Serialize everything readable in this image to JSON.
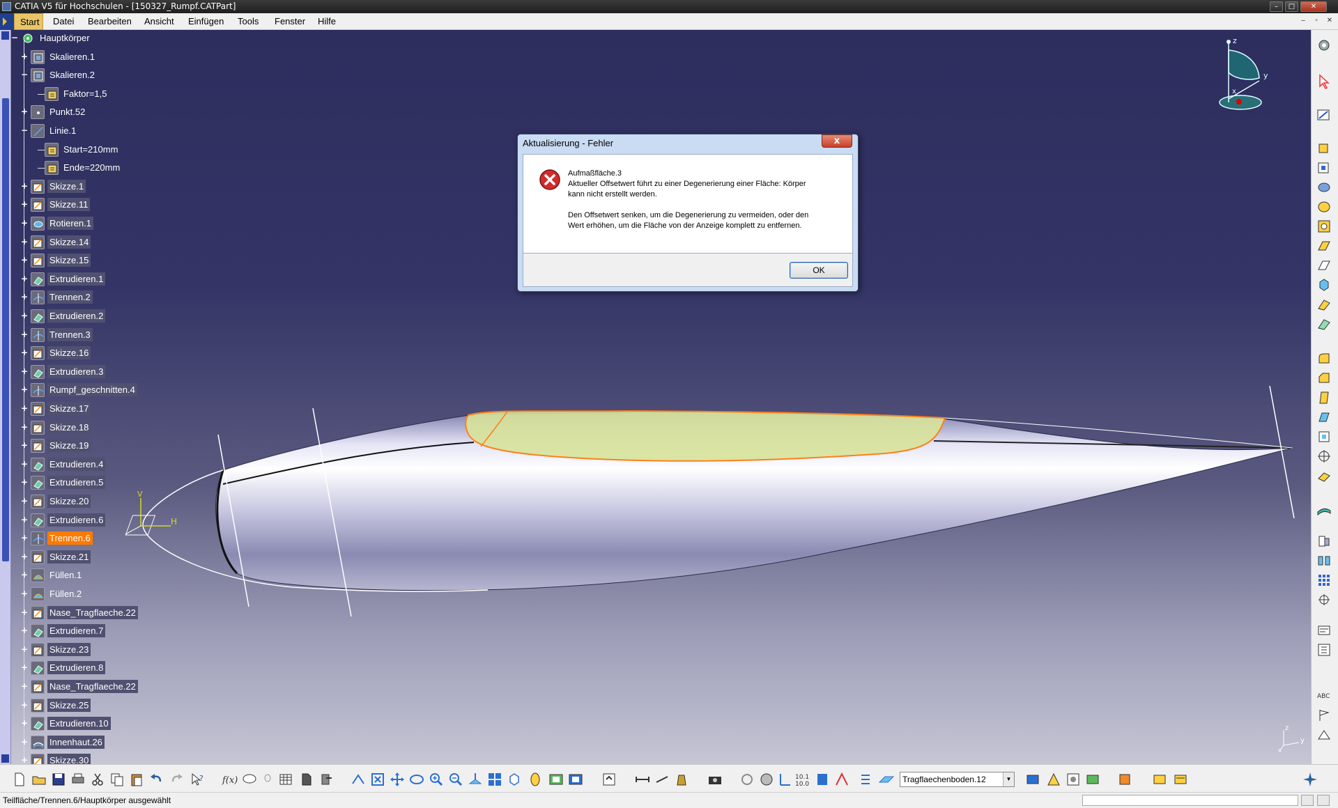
{
  "window": {
    "title": "CATIA V5 für Hochschulen - [150327_Rumpf.CATPart]",
    "controls": [
      "–",
      "□",
      "✕"
    ],
    "mdi_controls": [
      "–",
      "▫",
      "✕"
    ]
  },
  "menu": [
    "Start",
    "Datei",
    "Bearbeiten",
    "Ansicht",
    "Einfügen",
    "Tools",
    "Fenster",
    "Hilfe"
  ],
  "tree": [
    {
      "label": "Hauptkörper",
      "icon": "gear-body-icon",
      "state": "root"
    },
    {
      "label": "Skalieren.1",
      "icon": "scale-icon"
    },
    {
      "label": "Skalieren.2",
      "icon": "scale-icon",
      "expanded": true
    },
    {
      "label": "Faktor=1,5",
      "icon": "parameter-icon",
      "child": true
    },
    {
      "label": "Punkt.52",
      "icon": "point-icon"
    },
    {
      "label": "Linie.1",
      "icon": "line-icon",
      "expanded": true
    },
    {
      "label": "Start=210mm",
      "icon": "parameter-icon",
      "child": true
    },
    {
      "label": "Ende=220mm",
      "icon": "parameter-icon",
      "child": true
    },
    {
      "label": "Skizze.1",
      "icon": "sketch-icon"
    },
    {
      "label": "Skizze.11",
      "icon": "sketch-icon"
    },
    {
      "label": "Rotieren.1",
      "icon": "revolve-icon"
    },
    {
      "label": "Skizze.14",
      "icon": "sketch-icon"
    },
    {
      "label": "Skizze.15",
      "icon": "sketch-icon"
    },
    {
      "label": "Extrudieren.1",
      "icon": "extrude-icon"
    },
    {
      "label": "Trennen.2",
      "icon": "split-icon"
    },
    {
      "label": "Extrudieren.2",
      "icon": "extrude-icon"
    },
    {
      "label": "Trennen.3",
      "icon": "split-icon"
    },
    {
      "label": "Skizze.16",
      "icon": "sketch-icon"
    },
    {
      "label": "Extrudieren.3",
      "icon": "extrude-icon"
    },
    {
      "label": "Rumpf_geschnitten.4",
      "icon": "split-icon"
    },
    {
      "label": "Skizze.17",
      "icon": "sketch-icon"
    },
    {
      "label": "Skizze.18",
      "icon": "sketch-icon"
    },
    {
      "label": "Skizze.19",
      "icon": "sketch-icon"
    },
    {
      "label": "Extrudieren.4",
      "icon": "extrude-icon"
    },
    {
      "label": "Extrudieren.5",
      "icon": "extrude-icon"
    },
    {
      "label": "Skizze.20",
      "icon": "sketch-icon"
    },
    {
      "label": "Extrudieren.6",
      "icon": "extrude-icon"
    },
    {
      "label": "Trennen.6",
      "icon": "split-icon",
      "selected": true
    },
    {
      "label": "Skizze.21",
      "icon": "sketch-icon"
    },
    {
      "label": "Füllen.1",
      "icon": "fill-icon"
    },
    {
      "label": "Füllen.2",
      "icon": "fill-icon"
    },
    {
      "label": "Nase_Tragflaeche.22",
      "icon": "sketch-icon"
    },
    {
      "label": "Extrudieren.7",
      "icon": "extrude-icon"
    },
    {
      "label": "Skizze.23",
      "icon": "sketch-icon"
    },
    {
      "label": "Extrudieren.8",
      "icon": "extrude-icon"
    },
    {
      "label": "Nase_Tragflaeche.22",
      "icon": "sketch-icon"
    },
    {
      "label": "Skizze.25",
      "icon": "sketch-icon"
    },
    {
      "label": "Extrudieren.10",
      "icon": "extrude-icon"
    },
    {
      "label": "Innenhaut.26",
      "icon": "offset-icon"
    },
    {
      "label": "Skizze.30",
      "icon": "sketch-icon"
    }
  ],
  "viewer": {
    "axis_labels": {
      "v": "V",
      "h": "H"
    },
    "compass_labels": {
      "z": "z",
      "y": "y",
      "x": "x"
    },
    "mini_axes": {
      "z": "z",
      "y": "y",
      "x": "x"
    },
    "colors": {
      "body": "#d8d8f0",
      "highlight_face": "#d7e39a",
      "highlight_edge": "#ff7f1a"
    }
  },
  "dialog": {
    "title": "Aktualisierung - Fehler",
    "close": "x",
    "heading": "Aufmaßfläche.3",
    "line1": "Aktueller Offsetwert führt zu einer Degenerierung einer Fläche: Körper",
    "line2": "kann nicht erstellt werden.",
    "line3": "Den Offsetwert senken, um die Degenerierung zu vermeiden, oder den",
    "line4": "Wert erhöhen, um die Fläche von der Anzeige komplett zu entfernen.",
    "ok": "OK",
    "icon": "error-icon"
  },
  "toolbar": {
    "combo_value": "Tragflaechenboden.12"
  },
  "status": {
    "text": "Teilfläche/Trennen.6/Hauptkörper ausgewählt"
  }
}
